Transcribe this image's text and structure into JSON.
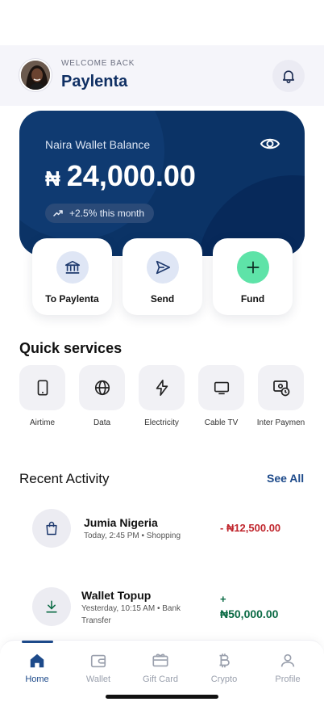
{
  "header": {
    "welcome_label": "WELCOME BACK",
    "username": "Paylenta"
  },
  "wallet": {
    "label": "Naira Wallet Balance",
    "currency_symbol": "₦",
    "amount": "24,000.00",
    "change": "+2.5% this month",
    "card_color": "#0b3366"
  },
  "actions": [
    {
      "label": "To Paylenta",
      "icon": "bank-icon"
    },
    {
      "label": "Send",
      "icon": "send-icon"
    },
    {
      "label": "Fund",
      "icon": "plus-icon"
    }
  ],
  "quick_services": {
    "title": "Quick services",
    "items": [
      {
        "label": "Airtime",
        "icon": "phone-icon"
      },
      {
        "label": "Data",
        "icon": "globe-icon"
      },
      {
        "label": "Electricity",
        "icon": "bolt-icon"
      },
      {
        "label": "Cable TV",
        "icon": "tv-icon"
      },
      {
        "label": "Inter Paymen",
        "icon": "payment-icon"
      }
    ]
  },
  "recent_activity": {
    "title": "Recent Activity",
    "see_all": "See All",
    "items": [
      {
        "name": "Jumia Nigeria",
        "meta": "Today, 2:45 PM • Shopping",
        "amount": "- ₦12,500.00",
        "type": "debit",
        "icon": "shopping-bag-icon"
      },
      {
        "name": "Wallet Topup",
        "meta": "Yesterday, 10:15 AM • Bank Transfer",
        "amount_sign": "+",
        "amount": "₦50,000.00",
        "type": "credit",
        "icon": "download-icon"
      }
    ]
  },
  "colors": {
    "accent": "#1d4a8a",
    "debit": "#c0262d",
    "credit": "#0b6b45",
    "fund": "#5ee3a8"
  },
  "nav": [
    {
      "label": "Home",
      "icon": "home-icon",
      "active": true
    },
    {
      "label": "Wallet",
      "icon": "wallet-icon"
    },
    {
      "label": "Gift Card",
      "icon": "gift-card-icon"
    },
    {
      "label": "Crypto",
      "icon": "bitcoin-icon"
    },
    {
      "label": "Profile",
      "icon": "user-icon"
    }
  ]
}
